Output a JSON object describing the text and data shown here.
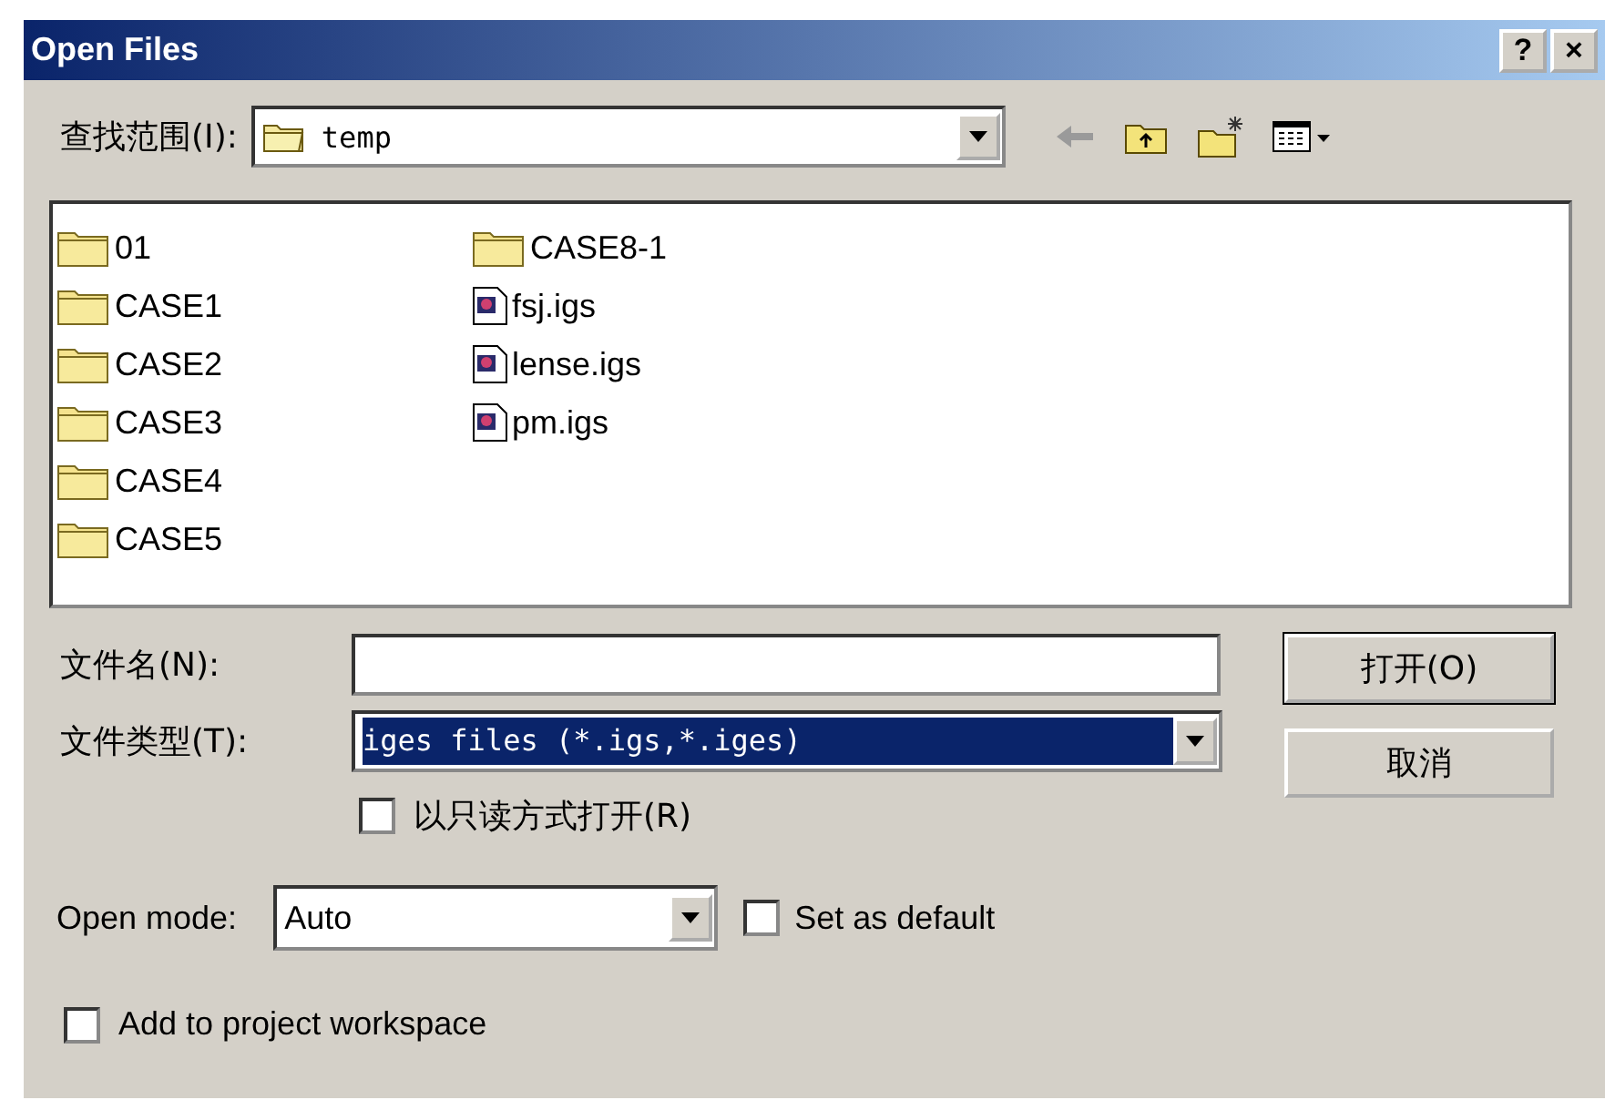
{
  "window": {
    "title": "Open Files",
    "title_buttons": [
      "?",
      "×"
    ]
  },
  "look_in": {
    "label": "查找范围(I):",
    "value": "temp"
  },
  "files": [
    {
      "name": "01",
      "kind": "folder"
    },
    {
      "name": "CASE1",
      "kind": "folder"
    },
    {
      "name": "CASE2",
      "kind": "folder"
    },
    {
      "name": "CASE3",
      "kind": "folder"
    },
    {
      "name": "CASE4",
      "kind": "folder"
    },
    {
      "name": "CASE5",
      "kind": "folder"
    },
    {
      "name": "CASE8-1",
      "kind": "folder"
    },
    {
      "name": "fsj.igs",
      "kind": "file"
    },
    {
      "name": "lense.igs",
      "kind": "file"
    },
    {
      "name": "pm.igs",
      "kind": "file"
    }
  ],
  "file_name": {
    "label": "文件名(N):"
  },
  "file_type": {
    "label": "文件类型(T):",
    "value": "iges files (*.igs,*.iges)"
  },
  "read_only": {
    "label": "以只读方式打开(R)",
    "checked": false
  },
  "open_mode": {
    "label": "Open mode:",
    "value": "Auto"
  },
  "set_default": {
    "label": "Set as default",
    "checked": false
  },
  "add_to_project": {
    "label": "Add to project workspace",
    "checked": false
  },
  "buttons": [
    "打开(O)",
    "取消"
  ]
}
